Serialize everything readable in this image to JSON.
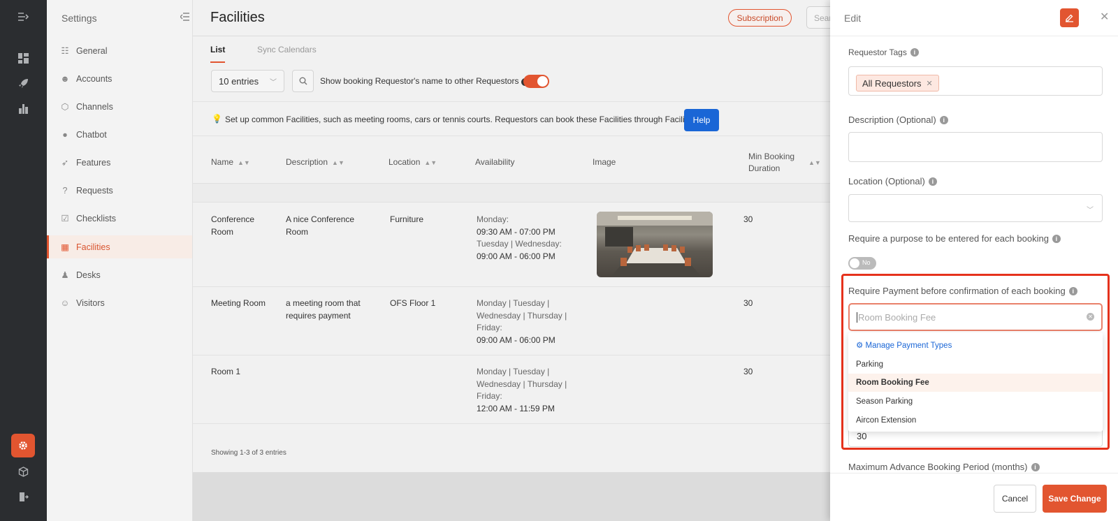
{
  "settings": {
    "title": "Settings",
    "items": [
      {
        "label": "General",
        "icon": "sliders-icon"
      },
      {
        "label": "Accounts",
        "icon": "users-icon"
      },
      {
        "label": "Channels",
        "icon": "cube-icon"
      },
      {
        "label": "Chatbot",
        "icon": "chat-icon"
      },
      {
        "label": "Features",
        "icon": "rocket-icon"
      },
      {
        "label": "Requests",
        "icon": "question-icon"
      },
      {
        "label": "Checklists",
        "icon": "checklist-icon"
      },
      {
        "label": "Facilities",
        "icon": "calendar-icon",
        "active": true
      },
      {
        "label": "Desks",
        "icon": "desk-icon"
      },
      {
        "label": "Visitors",
        "icon": "visitor-icon"
      }
    ]
  },
  "page": {
    "title": "Facilities",
    "subscription_label": "Subscription",
    "search_placeholder": "Search"
  },
  "tabs": {
    "list": "List",
    "sync": "Sync Calendars"
  },
  "toolbar": {
    "entries": "10 entries",
    "show_label": "Show booking Requestor's name to other Requestors",
    "show_on": true
  },
  "info": {
    "text": "Set up common Facilities, such as meeting rooms, cars or tennis courts. Requestors can book these Facilities through FacilityBot.",
    "help_label": "Help"
  },
  "table": {
    "headers": {
      "name": "Name",
      "description": "Description",
      "location": "Location",
      "availability": "Availability",
      "image": "Image",
      "min_duration": "Min Booking Duration"
    },
    "rows": [
      {
        "name": "Conference Room",
        "description": "A nice Conference Room",
        "location": "Furniture",
        "avail1_label": "Monday:",
        "avail1_time": "09:30 AM - 07:00 PM",
        "avail2_label": "Tuesday | Wednesday:",
        "avail2_time": "09:00 AM - 06:00 PM",
        "min": "30"
      },
      {
        "name": "Meeting Room",
        "description": "a meeting room that requires payment",
        "location": "OFS Floor 1",
        "avail1_label": "Monday | Tuesday | Wednesday | Thursday | Friday:",
        "avail1_time": "09:00 AM - 06:00 PM",
        "min": "30"
      },
      {
        "name": "Room 1",
        "description": "",
        "location": "",
        "avail1_label": "Monday | Tuesday | Wednesday | Thursday | Friday:",
        "avail1_time": "12:00 AM - 11:59 PM",
        "min": "30"
      }
    ],
    "showing": "Showing 1-3 of 3 entries"
  },
  "edit": {
    "title": "Edit",
    "requestor_tags_label": "Requestor Tags",
    "tag": "All Requestors",
    "description_label": "Description (Optional)",
    "location_label": "Location (Optional)",
    "purpose_label": "Require a purpose to be entered for each booking",
    "purpose_toggle": "No",
    "payment_label": "Require Payment before confirmation of each booking",
    "payment_placeholder": "Room Booking Fee",
    "manage_label": "Manage Payment Types",
    "options": [
      "Parking",
      "Room Booking Fee",
      "Season Parking",
      "Aircon Extension"
    ],
    "selected_option": "Room Booking Fee",
    "duration_value": "30",
    "max_advance_label": "Maximum Advance Booking Period (months)",
    "cancel_label": "Cancel",
    "save_label": "Save Change"
  },
  "colors": {
    "accent": "#e25530",
    "link": "#1a66d6",
    "highlight": "#e5321c"
  }
}
